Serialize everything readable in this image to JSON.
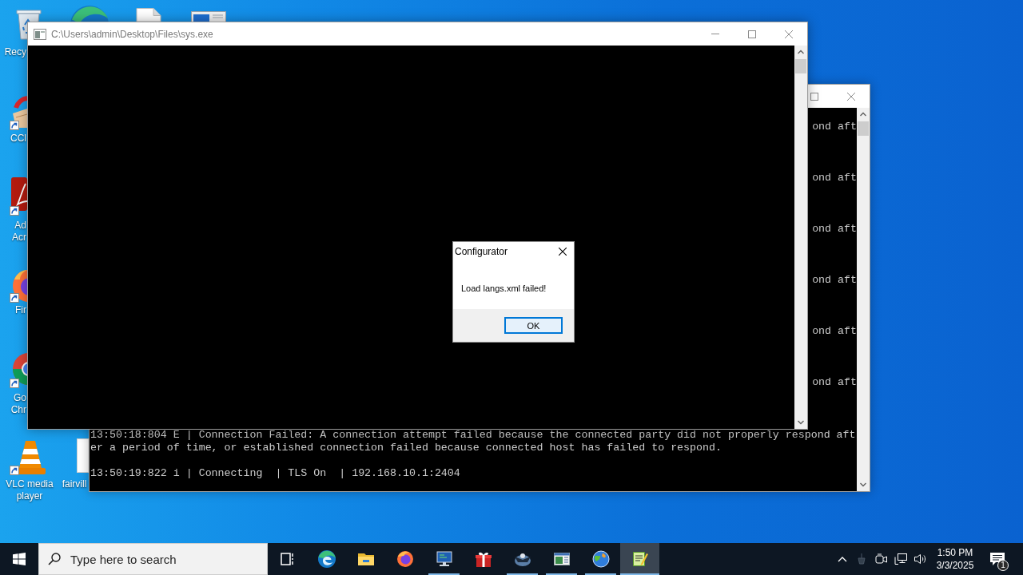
{
  "desktop": {
    "partial_icons": [
      {
        "kind": "edge"
      },
      {
        "kind": "document"
      },
      {
        "kind": "window"
      }
    ],
    "icons": [
      {
        "kind": "bin",
        "label": "Recy",
        "shortcut": false
      },
      {
        "kind": "cleaner",
        "label": "CCl",
        "shortcut": true
      },
      {
        "kind": "pdf",
        "label": "Ad Acr",
        "shortcut": true
      },
      {
        "kind": "firefox",
        "label": "Fir",
        "shortcut": true
      },
      {
        "kind": "chrome",
        "label": "Go Chr",
        "shortcut": true
      },
      {
        "kind": "vlc",
        "label": "VLC media player",
        "shortcut": true
      },
      {
        "kind": "file",
        "label": "fairvill",
        "shortcut": false
      }
    ]
  },
  "back_console": {
    "fragments": [
      "ond aft",
      "ond aft",
      "ond aft",
      "ond aft",
      "ond aft",
      "ond aft"
    ],
    "entries": [
      {
        "kind": "error",
        "lines": [
          "13:50:18:804 E | Connection Failed: A connection attempt failed because the connected party did not properly respond aft",
          "er a period of time, or established connection failed because connected host has failed to respond."
        ]
      },
      {
        "kind": "info",
        "lines": [
          "13:50:19:822 i | Connecting  | TLS On  | 192.168.10.1:2404"
        ]
      }
    ]
  },
  "console_window": {
    "title": "C:\\Users\\admin\\Desktop\\Files\\sys.exe",
    "active": false
  },
  "dialog": {
    "title": "Configurator",
    "message": "Load langs.xml failed!",
    "buttons": [
      {
        "label": "OK",
        "focused": true
      }
    ]
  },
  "taskbar": {
    "search": {
      "placeholder": "Type here to search"
    },
    "apps": [
      {
        "kind": "taskview",
        "running": false,
        "active": false
      },
      {
        "kind": "edge",
        "running": false,
        "active": false
      },
      {
        "kind": "explorer",
        "running": false,
        "active": false
      },
      {
        "kind": "firefox",
        "running": false,
        "active": false
      },
      {
        "kind": "terminal",
        "running": true,
        "active": false
      },
      {
        "kind": "gift",
        "running": false,
        "active": false
      },
      {
        "kind": "emblem",
        "running": true,
        "active": false
      },
      {
        "kind": "window",
        "running": true,
        "active": false
      },
      {
        "kind": "globe",
        "running": true,
        "active": false
      },
      {
        "kind": "notepad",
        "running": true,
        "active": true
      }
    ],
    "tray": {
      "time": "1:50 PM",
      "date": "3/3/2025",
      "notification_count": "1"
    }
  }
}
